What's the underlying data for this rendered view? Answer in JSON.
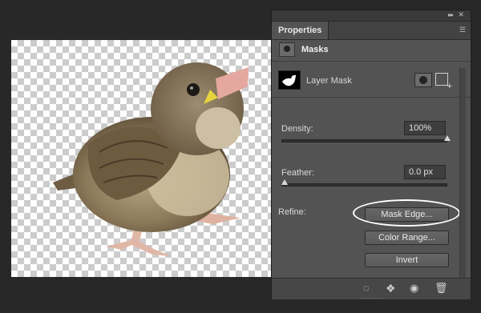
{
  "canvas": {
    "subject": "sparrow-chick-cutout"
  },
  "panel": {
    "tab_label": "Properties",
    "section_title": "Masks",
    "layer_mask_label": "Layer Mask",
    "density": {
      "label": "Density:",
      "value": "100%",
      "level": 1.0
    },
    "feather": {
      "label": "Feather:",
      "value": "0.0 px",
      "level": 0.0
    },
    "refine_label": "Refine:",
    "buttons": {
      "mask_edge": "Mask Edge...",
      "color_range": "Color Range...",
      "invert": "Invert"
    },
    "icons": {
      "collapse": "double-chevron-right-icon",
      "close": "close-icon",
      "panel_menu": "hamburger-menu-icon",
      "load_selection": "dotted-circle-selection-icon",
      "apply_mask": "apply-mask-diamond-icon",
      "visibility": "eye-icon",
      "delete": "trash-icon"
    },
    "highlight_color": "#ffffff"
  }
}
